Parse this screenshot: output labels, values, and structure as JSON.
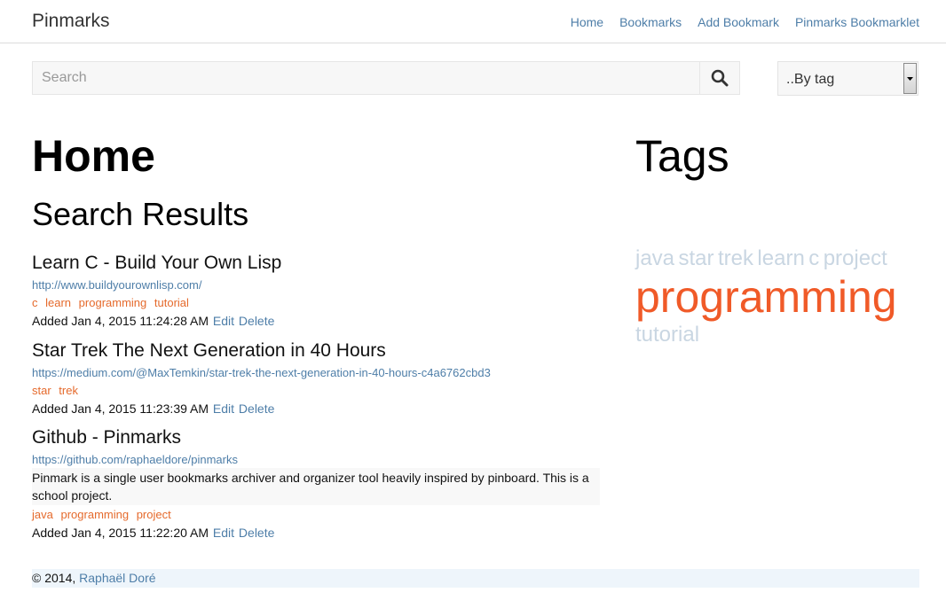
{
  "nav": {
    "brand": "Pinmarks",
    "links": [
      "Home",
      "Bookmarks",
      "Add Bookmark",
      "Pinmarks Bookmarklet"
    ]
  },
  "search": {
    "placeholder": "Search",
    "value": ""
  },
  "tag_select": {
    "selected": "..By tag"
  },
  "headings": {
    "home": "Home",
    "results": "Search Results",
    "tags": "Tags"
  },
  "bookmarks": [
    {
      "title": "Learn C - Build Your Own Lisp",
      "url": "http://www.buildyourownlisp.com/",
      "description": "",
      "tags": [
        "c",
        "learn",
        "programming",
        "tutorial"
      ],
      "added": "Added Jan 4, 2015 11:24:28 AM",
      "edit": "Edit",
      "delete": "Delete"
    },
    {
      "title": "Star Trek The Next Generation in 40 Hours",
      "url": "https://medium.com/@MaxTemkin/star-trek-the-next-generation-in-40-hours-c4a6762cbd3",
      "description": "",
      "tags": [
        "star",
        "trek"
      ],
      "added": "Added Jan 4, 2015 11:23:39 AM",
      "edit": "Edit",
      "delete": "Delete"
    },
    {
      "title": "Github - Pinmarks",
      "url": "https://github.com/raphaeldore/pinmarks",
      "description": "Pinmark is a single user bookmarks archiver and organizer tool heavily inspired by pinboard. This is a school project.",
      "tags": [
        "java",
        "programming",
        "project"
      ],
      "added": "Added Jan 4, 2015 11:22:20 AM",
      "edit": "Edit",
      "delete": "Delete"
    }
  ],
  "tag_cloud": {
    "row1": [
      "java",
      "star",
      "trek",
      "learn",
      "c",
      "project"
    ],
    "big": "programming",
    "row3": [
      "tutorial"
    ]
  },
  "footer": {
    "copyright": "© 2014,",
    "author": "Raphaël Doré"
  },
  "colors": {
    "link": "#4e7ea8",
    "tag": "#e56a2c",
    "cloud_big": "#f05a28",
    "cloud_small": "#c9d6e2"
  }
}
